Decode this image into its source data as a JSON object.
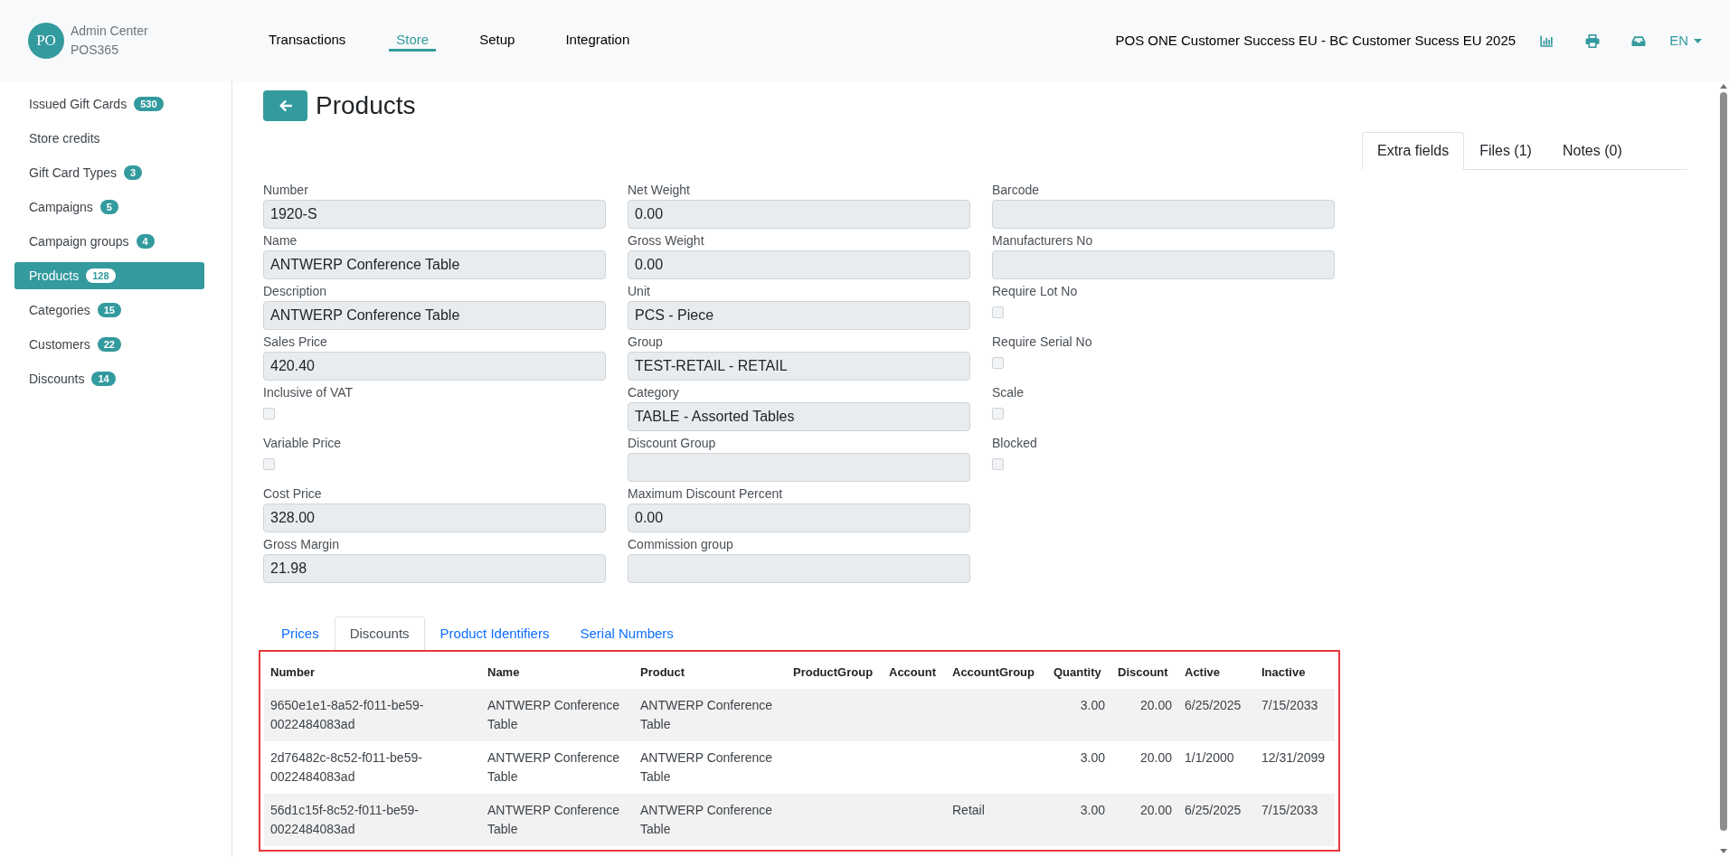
{
  "header": {
    "avatar": "PO",
    "app_name": "Admin Center",
    "app_subtitle": "POS365",
    "nav": [
      {
        "label": "Transactions",
        "selected": false
      },
      {
        "label": "Store",
        "selected": true
      },
      {
        "label": "Setup",
        "selected": false
      },
      {
        "label": "Integration",
        "selected": false
      }
    ],
    "company": "POS ONE Customer Success EU - BC Customer Sucess EU 2025",
    "language": "EN"
  },
  "sidebar": {
    "items": [
      {
        "label": "Issued Gift Cards",
        "count": "530",
        "selected": false
      },
      {
        "label": "Store credits",
        "selected": false
      },
      {
        "label": "Gift Card Types",
        "count": "3",
        "selected": false
      },
      {
        "label": "Campaigns",
        "count": "5",
        "selected": false
      },
      {
        "label": "Campaign groups",
        "count": "4",
        "selected": false
      },
      {
        "label": "Products",
        "count": "128",
        "selected": true
      },
      {
        "label": "Categories",
        "count": "15",
        "selected": false
      },
      {
        "label": "Customers",
        "count": "22",
        "selected": false
      },
      {
        "label": "Discounts",
        "count": "14",
        "selected": false
      }
    ]
  },
  "page": {
    "title": "Products"
  },
  "side_tabs": [
    {
      "label": "Extra fields",
      "selected": true
    },
    {
      "label": "Files (1)",
      "selected": false
    },
    {
      "label": "Notes (0)",
      "selected": false
    }
  ],
  "form": {
    "columns": [
      {
        "fields": [
          {
            "kind": "text",
            "label": "Number",
            "value": "1920-S"
          },
          {
            "kind": "text",
            "label": "Name",
            "value": "ANTWERP Conference Table"
          },
          {
            "kind": "text",
            "label": "Description",
            "value": "ANTWERP Conference Table"
          },
          {
            "kind": "text",
            "label": "Sales Price",
            "value": "420.40"
          },
          {
            "kind": "checkbox",
            "label": "Inclusive of VAT",
            "checked": false
          },
          {
            "kind": "checkbox",
            "label": "Variable Price",
            "checked": false
          },
          {
            "kind": "text",
            "label": "Cost Price",
            "value": "328.00"
          },
          {
            "kind": "text",
            "label": "Gross Margin",
            "value": "21.98"
          }
        ]
      },
      {
        "fields": [
          {
            "kind": "text",
            "label": "Net Weight",
            "value": "0.00"
          },
          {
            "kind": "text",
            "label": "Gross Weight",
            "value": "0.00"
          },
          {
            "kind": "text",
            "label": "Unit",
            "value": "PCS - Piece"
          },
          {
            "kind": "text",
            "label": "Group",
            "value": "TEST-RETAIL - RETAIL"
          },
          {
            "kind": "text",
            "label": "Category",
            "value": "TABLE - Assorted Tables"
          },
          {
            "kind": "text",
            "label": "Discount Group"
          },
          {
            "kind": "text",
            "label": "Maximum Discount Percent",
            "value": "0.00"
          },
          {
            "kind": "text",
            "label": "Commission group"
          }
        ]
      },
      {
        "fields": [
          {
            "kind": "text",
            "label": "Barcode"
          },
          {
            "kind": "text",
            "label": "Manufacturers No"
          },
          {
            "kind": "checkbox",
            "label": "Require Lot No",
            "checked": false
          },
          {
            "kind": "checkbox",
            "label": "Require Serial No",
            "checked": false
          },
          {
            "kind": "checkbox",
            "label": "Scale",
            "checked": false
          },
          {
            "kind": "checkbox",
            "label": "Blocked",
            "checked": false
          }
        ]
      }
    ]
  },
  "detail_tabs": [
    {
      "label": "Prices",
      "selected": false
    },
    {
      "label": "Discounts",
      "selected": true
    },
    {
      "label": "Product Identifiers",
      "selected": false
    },
    {
      "label": "Serial Numbers",
      "selected": false
    }
  ],
  "discounts_table": {
    "highlighted": true,
    "columns": [
      {
        "label": "Number",
        "kind": "text"
      },
      {
        "label": "Name",
        "kind": "text"
      },
      {
        "label": "Product",
        "kind": "text"
      },
      {
        "label": "ProductGroup",
        "kind": "text"
      },
      {
        "label": "Account",
        "kind": "text"
      },
      {
        "label": "AccountGroup",
        "kind": "text"
      },
      {
        "label": "Quantity",
        "kind": "number"
      },
      {
        "label": "Discount",
        "kind": "number"
      },
      {
        "label": "Active",
        "kind": "text"
      },
      {
        "label": "Inactive",
        "kind": "text"
      }
    ],
    "rows": [
      {
        "cells": [
          "9650e1e1-8a52-f011-be59-0022484083ad",
          "ANTWERP Conference Table",
          "ANTWERP Conference Table",
          null,
          null,
          null,
          "3.00",
          "20.00",
          "6/25/2025",
          "7/15/2033"
        ]
      },
      {
        "cells": [
          "2d76482c-8c52-f011-be59-0022484083ad",
          "ANTWERP Conference Table",
          "ANTWERP Conference Table",
          null,
          null,
          null,
          "3.00",
          "20.00",
          "1/1/2000",
          "12/31/2099"
        ]
      },
      {
        "cells": [
          "56d1c15f-8c52-f011-be59-0022484083ad",
          "ANTWERP Conference Table",
          "ANTWERP Conference Table",
          null,
          null,
          "Retail",
          "3.00",
          "20.00",
          "6/25/2025",
          "7/15/2033"
        ]
      }
    ]
  }
}
